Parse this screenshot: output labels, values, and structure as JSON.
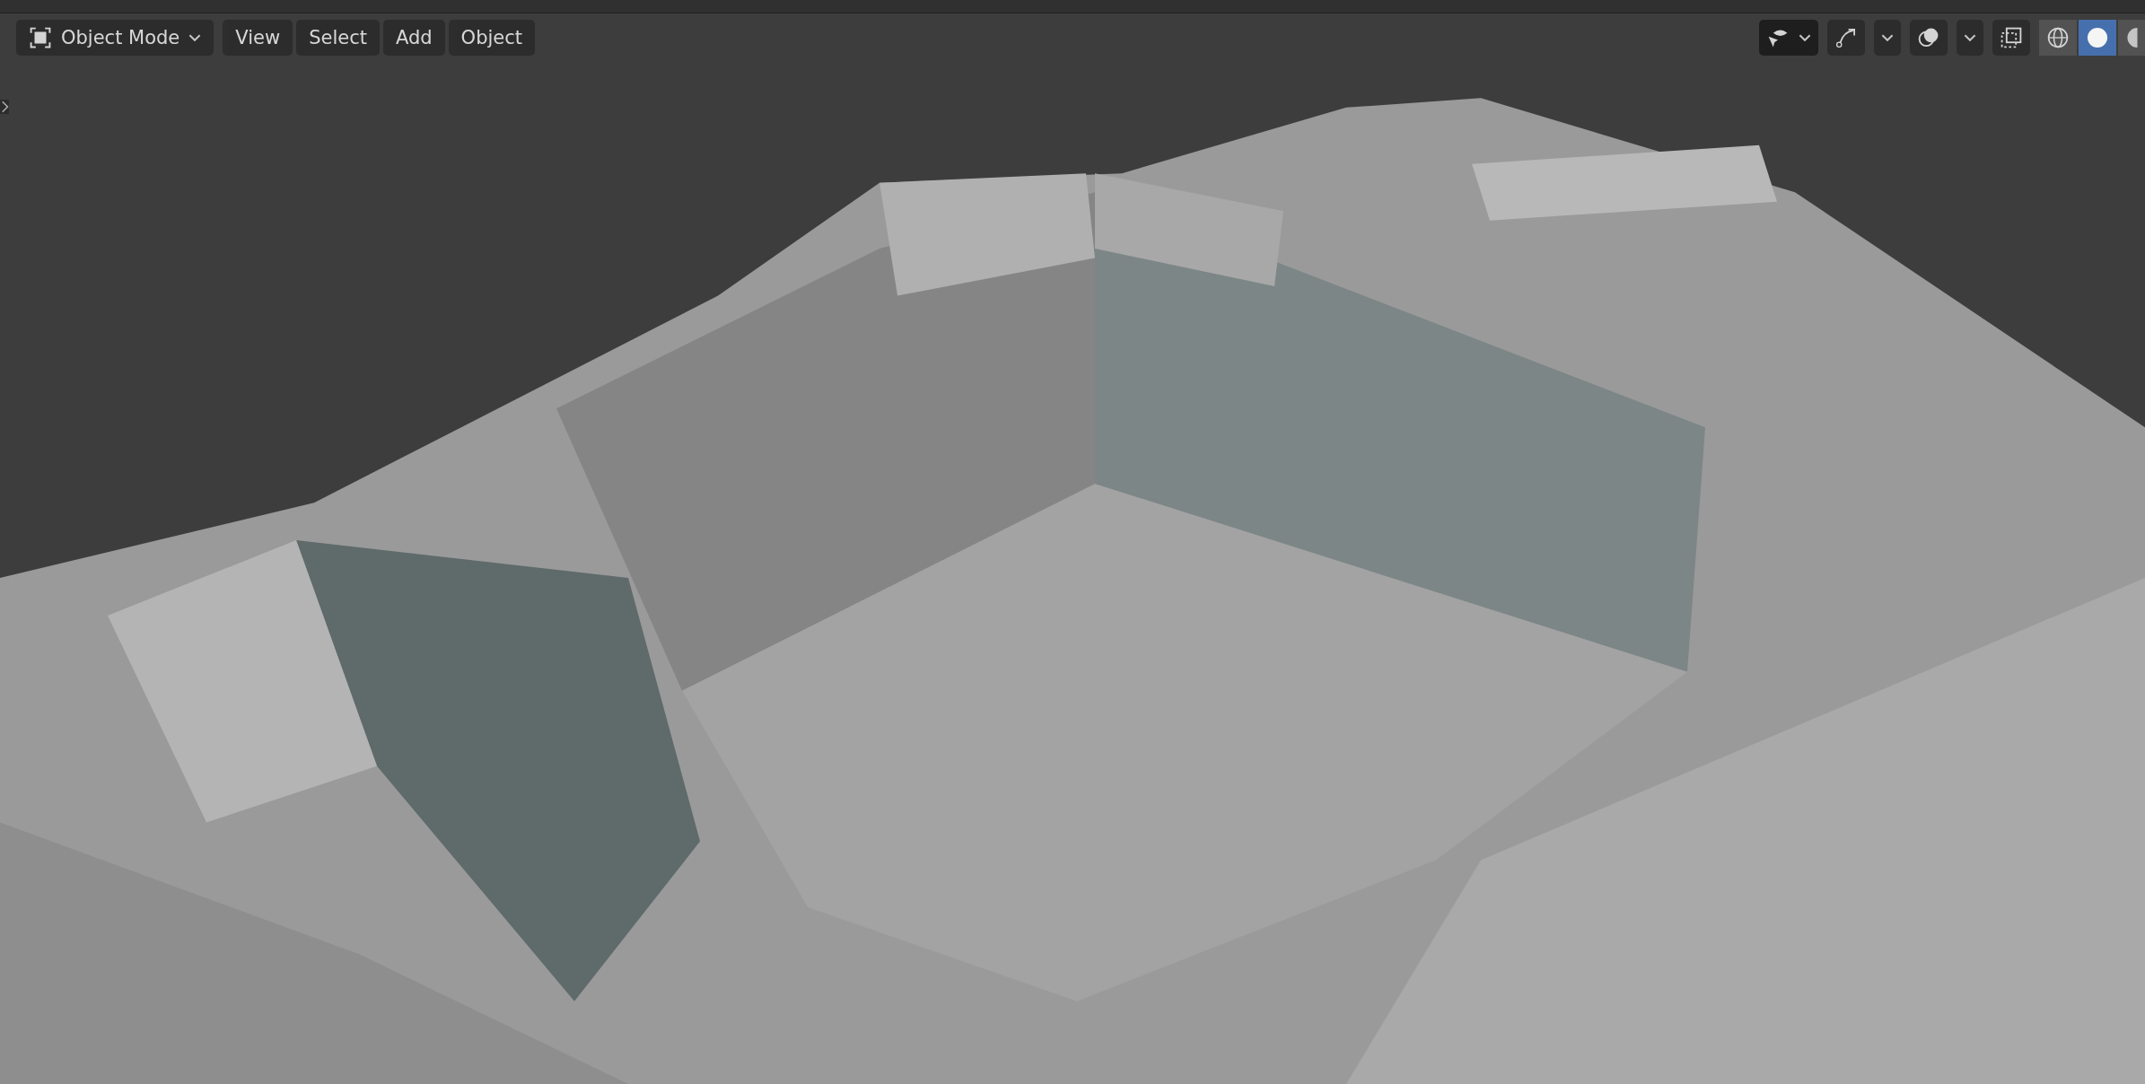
{
  "header": {
    "mode": {
      "label": "Object Mode"
    },
    "menus": [
      "View",
      "Select",
      "Add",
      "Object"
    ]
  },
  "shading": [
    {
      "kind": "wireframe",
      "selected": false
    },
    {
      "kind": "solid",
      "selected": true
    },
    {
      "kind": "material",
      "selected": false
    }
  ]
}
